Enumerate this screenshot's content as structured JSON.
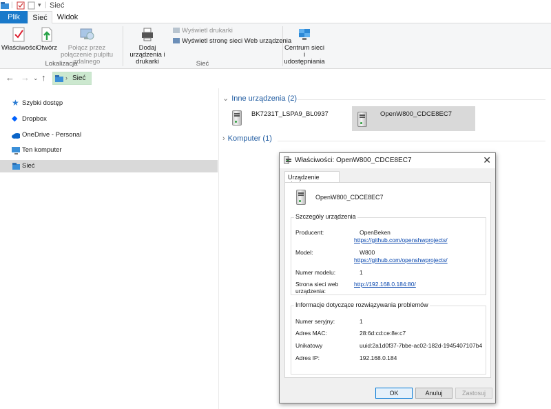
{
  "window": {
    "title": "Sieć"
  },
  "ribbon": {
    "tabs": [
      "Plik",
      "Sieć",
      "Widok"
    ],
    "buttons": {
      "properties": "Właściwości",
      "open": "Otwórz",
      "remote_desktop": "Połącz przez połączenie pulpitu zdalnego",
      "add_devices": "Dodaj urządzenia i drukarki",
      "show_printers": "Wyświetl drukarki",
      "show_web_page": "Wyświetl stronę sieci Web urządzenia",
      "network_center": "Centrum sieci i udostępniania"
    },
    "groups": {
      "location": "Lokalizacja",
      "network": "Sieć"
    }
  },
  "address": {
    "crumb": "Sieć"
  },
  "sidebar": {
    "items": [
      {
        "label": "Szybki dostęp",
        "icon": "star-icon",
        "selected": false
      },
      {
        "label": "Dropbox",
        "icon": "dropbox-icon",
        "selected": false
      },
      {
        "label": "OneDrive - Personal",
        "icon": "cloud-icon",
        "selected": false
      },
      {
        "label": "Ten komputer",
        "icon": "computer-icon",
        "selected": false
      },
      {
        "label": "Sieć",
        "icon": "network-icon",
        "selected": true
      }
    ]
  },
  "content": {
    "groups": {
      "other_devices": "Inne urządzenia (2)",
      "computer": "Komputer (1)"
    },
    "devices": [
      {
        "name": "BK7231T_LSPA9_BL0937",
        "selected": false
      },
      {
        "name": "OpenW800_CDCE8EC7",
        "selected": true
      }
    ]
  },
  "dialog": {
    "title": "Właściwości: OpenW800_CDCE8EC7",
    "tab": "Urządzenie sieciowe",
    "device_name": "OpenW800_CDCE8EC7",
    "details": {
      "legend": "Szczegóły urządzenia",
      "manufacturer_label": "Producent:",
      "manufacturer_value": "OpenBeken",
      "manufacturer_link": "https://github.com/openshwprojects/",
      "model_label": "Model:",
      "model_value": "W800",
      "model_link": "https://github.com/openshwprojects/",
      "model_number_label": "Numer modelu:",
      "model_number_value": "1",
      "web_page_label": "Strona sieci web urządzenia:",
      "web_page_link": "http://192.168.0.184:80/"
    },
    "troubleshooting": {
      "legend": "Informacje dotyczące rozwiązywania problemów",
      "serial_label": "Numer seryjny:",
      "serial_value": "1",
      "mac_label": "Adres MAC:",
      "mac_value": "28:6d:cd:ce:8e:c7",
      "unique_label": "Unikatowy",
      "unique_value": "uuid:2a1d0f37-7bbe-ac02-182d-1945407107b4",
      "ip_label": "Adres IP:",
      "ip_value": "192.168.0.184"
    },
    "buttons": {
      "ok": "OK",
      "cancel": "Anuluj",
      "apply": "Zastosuj"
    }
  },
  "colors": {
    "file_tab": "#1979ca",
    "selection": "#d9d9d9",
    "address_highlight": "#cce8cf",
    "link": "#0645ad"
  }
}
